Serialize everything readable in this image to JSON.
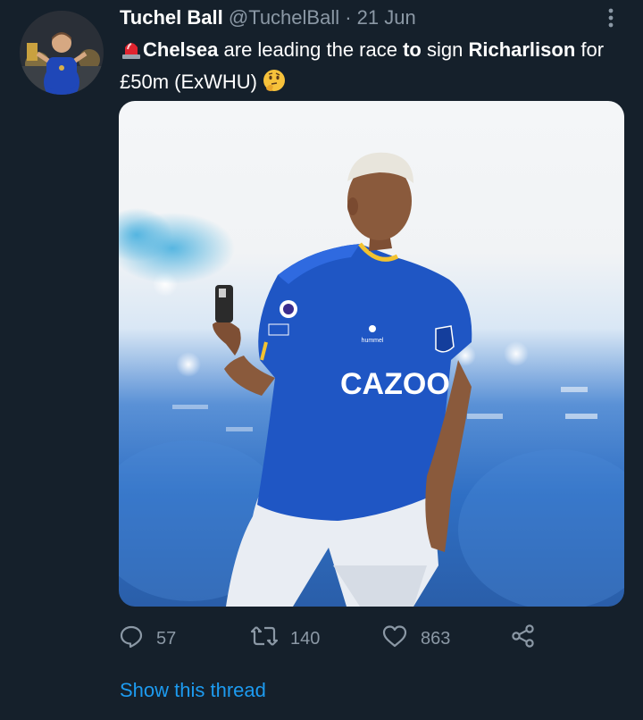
{
  "tweet": {
    "author_name": "Tuchel Ball",
    "handle": "@TuchelBall",
    "separator": "·",
    "date": "21 Jun",
    "text": {
      "part1": "Chelsea",
      "part2": " are leading the race ",
      "part3": "to",
      "part4": " sign ",
      "part5": "Richarlison",
      "part6": " for £50m (ExWHU) "
    },
    "image": {
      "sponsor_text": "CAZOO",
      "kit_brand": "hummel"
    },
    "icons": {
      "avatar": "avatar",
      "more": "more-vertical-icon",
      "siren": "siren-emoji-icon",
      "thinking": "thinking-face-emoji-icon",
      "reply": "reply-icon",
      "retweet": "retweet-icon",
      "like": "heart-icon",
      "share": "share-icon"
    },
    "stats": {
      "replies": "57",
      "retweets": "140",
      "likes": "863"
    },
    "show_thread": "Show this thread"
  },
  "colors": {
    "background": "#15202b",
    "secondary_text": "#8b98a5",
    "link": "#1d9bf0",
    "everton_blue": "#1f56c4"
  }
}
